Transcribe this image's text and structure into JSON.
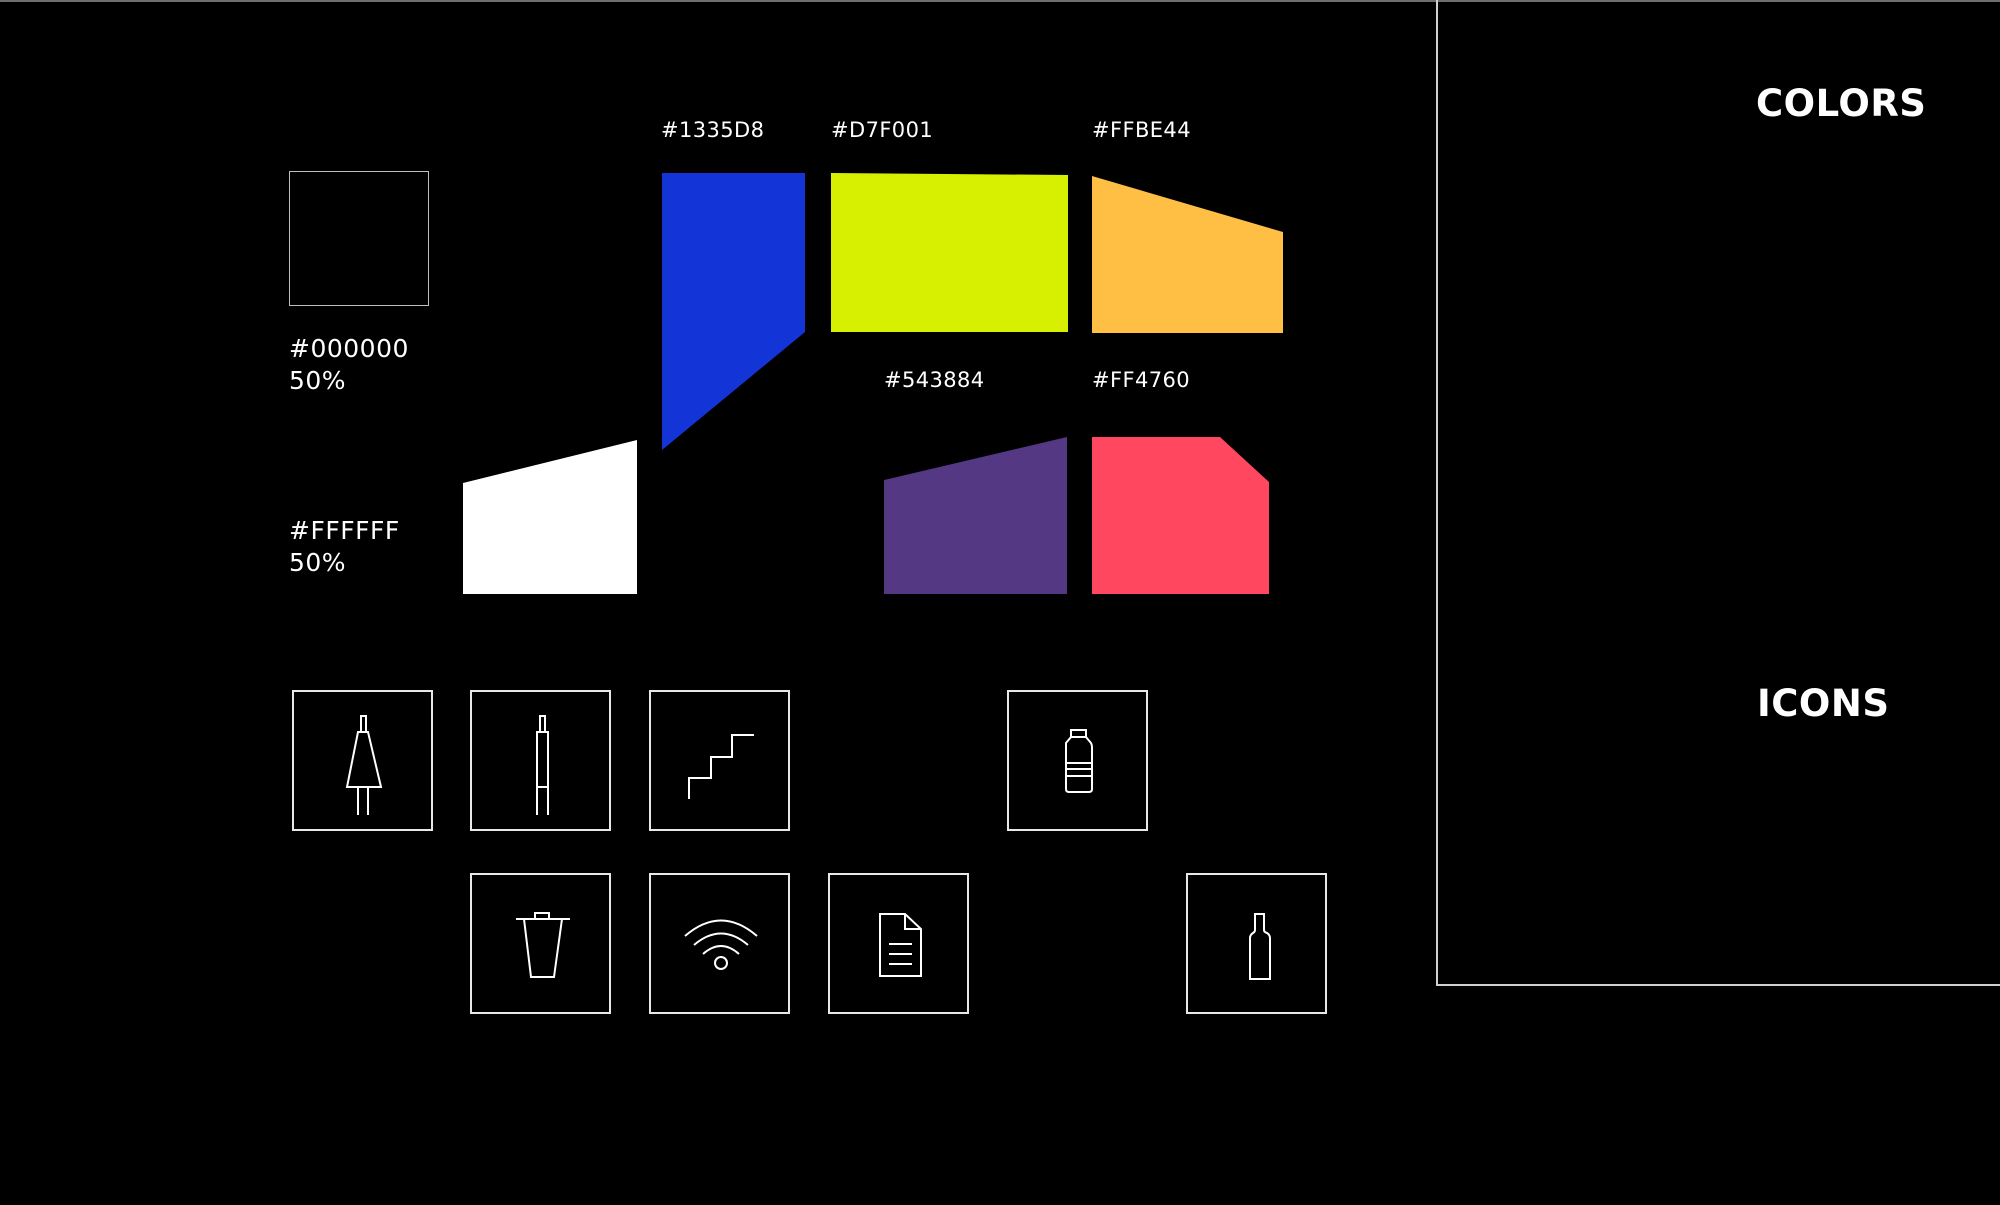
{
  "sections": {
    "colors_heading": "COLORS",
    "icons_heading": "ICONS"
  },
  "palette": {
    "black": {
      "hex": "#000000",
      "opacity": "50%",
      "color": "#000000"
    },
    "white": {
      "hex": "#FFFFFF",
      "opacity": "50%",
      "color": "#FFFFFF"
    },
    "swatches": [
      {
        "name": "blue",
        "label": "#1335D8",
        "color": "#1335D8"
      },
      {
        "name": "lime",
        "label": "#D7F001",
        "color": "#D7F001"
      },
      {
        "name": "amber",
        "label": "#FFBE44",
        "color": "#FFBE44"
      },
      {
        "name": "purple",
        "label": "#543884",
        "color": "#543884"
      },
      {
        "name": "coral",
        "label": "#FF4760",
        "color": "#FF4760"
      }
    ]
  },
  "icons": [
    {
      "name": "womens-restroom-icon"
    },
    {
      "name": "mens-restroom-icon"
    },
    {
      "name": "stairs-icon"
    },
    {
      "name": "water-bottle-icon"
    },
    {
      "name": "trash-can-icon"
    },
    {
      "name": "wifi-icon"
    },
    {
      "name": "document-icon"
    },
    {
      "name": "wine-bottle-icon"
    }
  ]
}
